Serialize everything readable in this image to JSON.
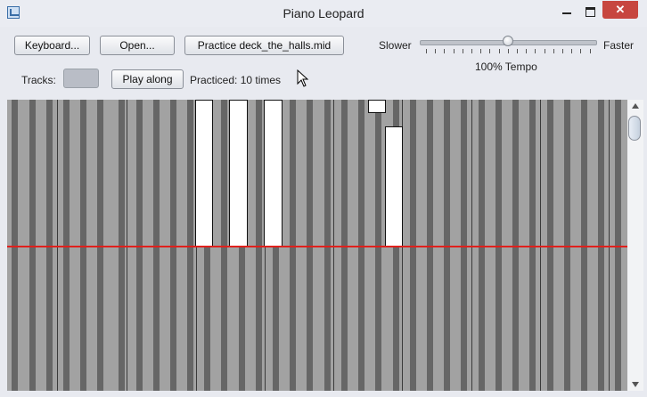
{
  "window": {
    "title": "Piano Leopard",
    "close_glyph": "✕",
    "app_icon": "piano-leopard-app-icon"
  },
  "toolbar": {
    "keyboard_label": "Keyboard...",
    "open_label": "Open...",
    "practice_label": "Practice deck_the_halls.mid",
    "slower_label": "Slower",
    "faster_label": "Faster",
    "tempo_label": "100% Tempo",
    "tempo_fraction": 0.5,
    "tracks_label": "Tracks:",
    "tracks_value": "",
    "play_along_label": "Play along",
    "practiced_label": "Practiced: 10 times"
  },
  "roll": {
    "background_color": "#a2a2a2",
    "black_key_color": "#666666",
    "white_key_separator_color": "#3a3a3a",
    "note_color": "#ffffff",
    "playhead_color": "#e0201c",
    "playhead_fraction": 0.5
  },
  "icons": {
    "minimize": "minimize-icon",
    "maximize": "maximize-icon",
    "close": "close-icon",
    "scroll_up": "scroll-up-icon",
    "scroll_down": "scroll-down-icon"
  }
}
